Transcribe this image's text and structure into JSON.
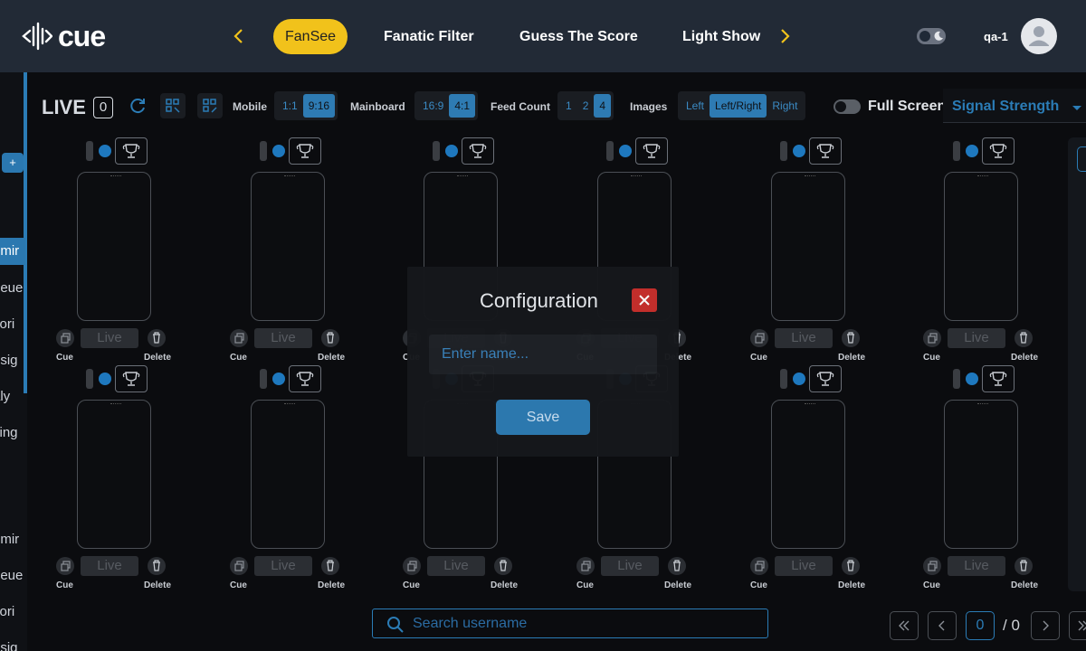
{
  "app": {
    "logo_text": "cue"
  },
  "nav": {
    "tabs": [
      {
        "label": "FanSee",
        "active": true
      },
      {
        "label": "Fanatic Filter"
      },
      {
        "label": "Guess The Score"
      },
      {
        "label": "Light Show"
      }
    ],
    "icons": [
      "chevron-left-icon",
      "chevron-right-icon",
      "moon-icon",
      "user-icon"
    ]
  },
  "user": {
    "name": "qa-1"
  },
  "sidebar": {
    "plus_label": "+",
    "items": [
      "dmir",
      "ueue",
      "vori",
      "esig",
      "aly",
      "zing",
      "dmir",
      "ueue",
      "vori",
      "esig"
    ]
  },
  "controls": {
    "live_label": "LIVE",
    "live_count": "0",
    "mobile_label": "Mobile",
    "mobile_options": [
      "1:1",
      "9:16"
    ],
    "mobile_selected": "9:16",
    "mainboard_label": "Mainboard",
    "mainboard_options": [
      "16:9",
      "4:1"
    ],
    "mainboard_selected": "4:1",
    "feed_count_label": "Feed Count",
    "feed_count_options": [
      "1",
      "2",
      "4"
    ],
    "feed_count_selected": "4",
    "images_label": "Images",
    "images_options": [
      "Left",
      "Left/Right",
      "Right"
    ],
    "images_selected": "Left/Right",
    "fullscreen_label": "Full Screen",
    "signal_label": "Signal Strength"
  },
  "tile": {
    "live_label": "Live",
    "cue_label": "Cue",
    "delete_label": "Delete"
  },
  "modal": {
    "title": "Configuration",
    "input_placeholder": "Enter name...",
    "save_label": "Save"
  },
  "search": {
    "placeholder": "Search username"
  },
  "pagination": {
    "current": "0",
    "total": "/ 0"
  },
  "colors": {
    "accent": "#2b7cb6",
    "active_tab": "#f1c21b",
    "header_bg": "#222a36",
    "close_red": "#c8302c"
  }
}
